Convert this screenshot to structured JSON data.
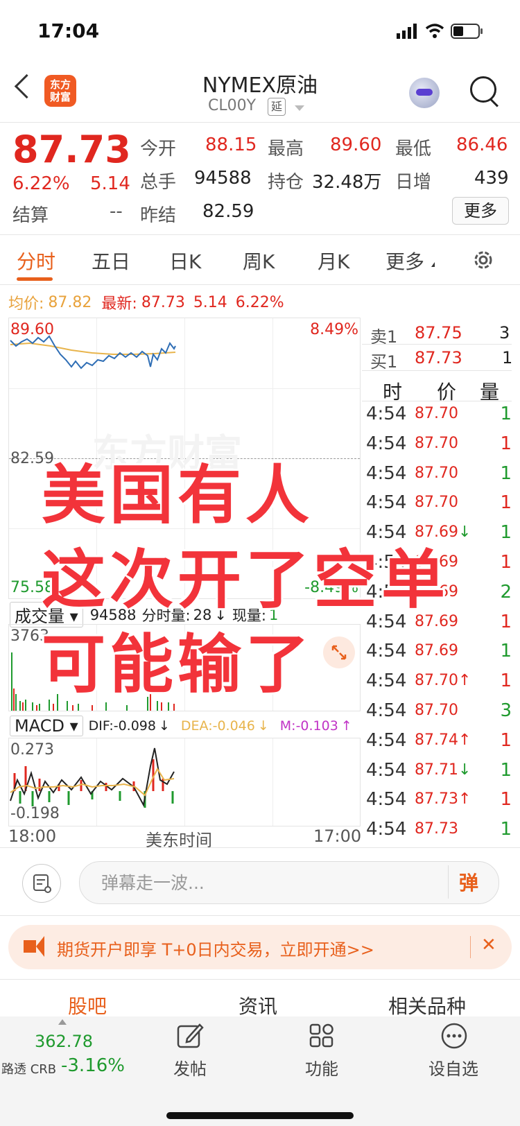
{
  "status": {
    "time": "17:04"
  },
  "header": {
    "title": "NYMEX原油",
    "subtitle": "CL00Y",
    "delay_badge": "延",
    "logo_line1": "东方",
    "logo_line2": "财富"
  },
  "quote": {
    "price": "87.73",
    "change_pct": "6.22%",
    "change": "5.14",
    "settle_label": "结算",
    "settle_value": "--",
    "open_label": "今开",
    "open": "88.15",
    "high_label": "最高",
    "high": "89.60",
    "low_label": "最低",
    "low": "86.46",
    "volume_label": "总手",
    "volume": "94588",
    "oi_label": "持仓",
    "oi": "32.48万",
    "daily_inc_label": "日增",
    "daily_inc": "439",
    "prev_settle_label": "昨结",
    "prev_settle": "82.59",
    "more_label": "更多"
  },
  "tabs": [
    "分时",
    "五日",
    "日K",
    "周K",
    "月K",
    "更多"
  ],
  "info": {
    "avg_label": "均价:",
    "avg": "87.82",
    "latest_label": "最新:",
    "latest": "87.73",
    "chg": "5.14",
    "pct": "6.22%"
  },
  "chart": {
    "y_top": "89.60",
    "pct_top": "8.49%",
    "y_mid": "82.59",
    "y_bottom": "75.58",
    "pct_bottom": "-8.49%",
    "watermark": "东方财富",
    "volume_selector": "成交量",
    "volume_info_total": "94588",
    "volume_info_min_label": "分时量:",
    "volume_info_min": "28",
    "volume_info_now_label": "现量:",
    "volume_info_now": "1",
    "volume_max": "3763",
    "macd_selector": "MACD",
    "dif": "DIF:-0.098",
    "dea": "DEA:-0.046",
    "m": "M:-0.103",
    "macd_top": "0.273",
    "macd_bottom": "-0.198",
    "x_start": "18:00",
    "x_mid": "美东时间",
    "x_end": "17:00"
  },
  "orderbook": {
    "sell_label": "卖1",
    "sell_price": "87.75",
    "sell_qty": "3",
    "buy_label": "买1",
    "buy_price": "87.73",
    "buy_qty": "1",
    "col_time": "时",
    "col_price": "价",
    "col_vol": "量",
    "trades": [
      {
        "time": "4:54",
        "price": "87.70",
        "vol": "1",
        "dir": ""
      },
      {
        "time": "4:54",
        "price": "87.70",
        "vol": "1",
        "dir": ""
      },
      {
        "time": "4:54",
        "price": "87.70",
        "vol": "1",
        "dir": ""
      },
      {
        "time": "4:54",
        "price": "87.70",
        "vol": "1",
        "dir": ""
      },
      {
        "time": "4:54",
        "price": "87.69",
        "vol": "1",
        "dir": "↓"
      },
      {
        "time": "4:54",
        "price": "87.69",
        "vol": "1",
        "dir": ""
      },
      {
        "time": "4:54",
        "price": "87.69",
        "vol": "2",
        "dir": ""
      },
      {
        "time": "4:54",
        "price": "87.69",
        "vol": "1",
        "dir": ""
      },
      {
        "time": "4:54",
        "price": "87.69",
        "vol": "1",
        "dir": ""
      },
      {
        "time": "4:54",
        "price": "87.70",
        "vol": "1",
        "dir": "↑"
      },
      {
        "time": "4:54",
        "price": "87.70",
        "vol": "3",
        "dir": ""
      },
      {
        "time": "4:54",
        "price": "87.74",
        "vol": "1",
        "dir": "↑"
      },
      {
        "time": "4:54",
        "price": "87.71",
        "vol": "1",
        "dir": "↓"
      },
      {
        "time": "4:54",
        "price": "87.73",
        "vol": "1",
        "dir": "↑"
      },
      {
        "time": "4:54",
        "price": "87.73",
        "vol": "1",
        "dir": ""
      }
    ]
  },
  "overlay": {
    "line1": "美国有人",
    "line2": "这次开了空单",
    "line3": "可能输了"
  },
  "danmaku": {
    "placeholder": "弹幕走一波...",
    "button": "弹"
  },
  "promo": {
    "text": "期货开户即享 T+0日内交易，立即开通>>",
    "close": "✕"
  },
  "section_tabs": [
    "股吧",
    "资讯",
    "相关品种"
  ],
  "bottom_nav": {
    "index_value": "362.78",
    "index_name": "路透 CRB",
    "index_change": "-3.16%",
    "post": "发帖",
    "functions": "功能",
    "watchlist": "设自选"
  },
  "colors": {
    "up": "#e0271f",
    "down": "#1f9a2e",
    "accent": "#e8601c",
    "price_line": "#2f6eb5",
    "avg_line": "#e8b44b"
  }
}
